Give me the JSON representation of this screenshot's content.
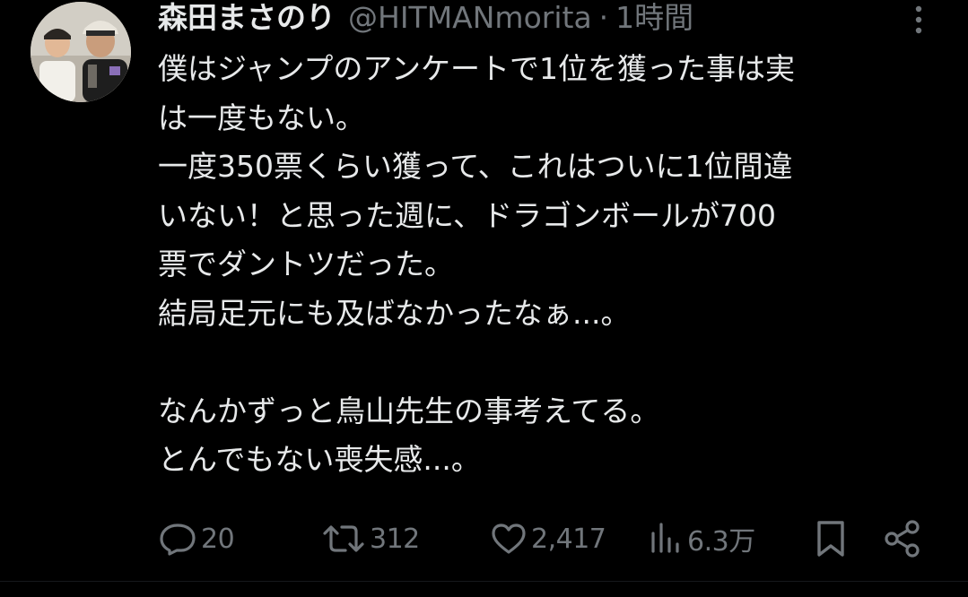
{
  "tweet": {
    "author_name": "森田まさのり",
    "handle": "@HITMANmorita",
    "separator": "·",
    "time": "1時間",
    "lines": [
      "僕はジャンプのアンケートで1位を獲った事は実",
      "は一度もない。",
      "一度350票くらい獲って、これはついに1位間違",
      "いない！と思った週に、ドラゴンボールが700",
      "票でダントツだった。",
      "結局足元にも及ばなかったなぁ...。",
      "",
      "なんかずっと鳥山先生の事考えてる。",
      "とんでもない喪失感...。"
    ]
  },
  "actions": {
    "reply_count": "20",
    "retweet_count": "312",
    "like_count": "2,417",
    "view_count": "6.3万"
  },
  "icons": {
    "more": "more-vertical-icon",
    "reply": "reply-icon",
    "retweet": "retweet-icon",
    "like": "heart-icon",
    "views": "views-bar-chart-icon",
    "bookmark": "bookmark-icon",
    "share": "share-icon"
  },
  "colors": {
    "background": "#000000",
    "text": "#e7e9ea",
    "muted": "#71767b"
  }
}
